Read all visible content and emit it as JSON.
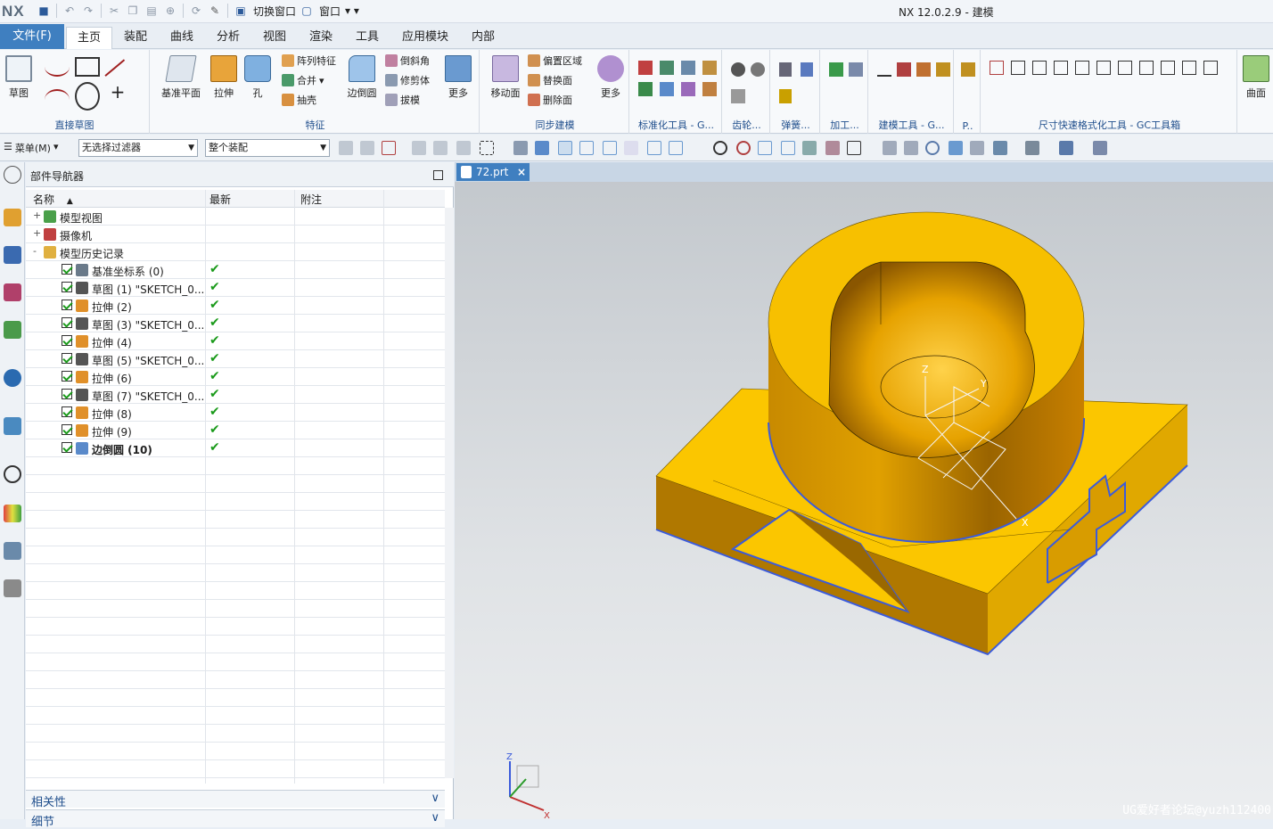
{
  "app": {
    "logo": "NX",
    "window_title": "NX 12.0.2.9 - 建模"
  },
  "qat": {
    "switch_window": "切换窗口",
    "window_menu": "窗口"
  },
  "tabs": [
    {
      "label": "文件(F)"
    },
    {
      "label": "主页"
    },
    {
      "label": "装配"
    },
    {
      "label": "曲线"
    },
    {
      "label": "分析"
    },
    {
      "label": "视图"
    },
    {
      "label": "渲染"
    },
    {
      "label": "工具"
    },
    {
      "label": "应用模块"
    },
    {
      "label": "内部"
    }
  ],
  "ribbon": {
    "sketch": "草图",
    "direct_sketch": "直接草图",
    "datum_plane": "基准平面",
    "extrude": "拉伸",
    "hole": "孔",
    "pattern_feature": "阵列特征",
    "unite": "合并",
    "shell": "抽壳",
    "edge_blend": "边倒圆",
    "chamfer": "倒斜角",
    "trim_body": "修剪体",
    "draft": "拔模",
    "more1": "更多",
    "feature": "特征",
    "move_face": "移动面",
    "offset_region": "偏置区域",
    "replace_face": "替换面",
    "delete_face": "删除面",
    "more2": "更多",
    "sync_modeling": "同步建模",
    "std_tools": "标准化工具 - G...",
    "gear": "齿轮...",
    "spring": "弹簧...",
    "machining": "加工...",
    "modeling_tools": "建模工具 - G...",
    "p_group": "P..",
    "dim_format": "尺寸快速格式化工具 - GC工具箱",
    "surface": "曲面"
  },
  "toolbar": {
    "menu": "菜单(M)",
    "filter": "无选择过滤器",
    "assembly": "整个装配"
  },
  "navigator": {
    "title": "部件导航器",
    "col_name": "名称",
    "col_latest": "最新",
    "col_note": "附注",
    "tree": [
      {
        "label": "模型视图",
        "level": 0,
        "checkbox": false,
        "ok": false,
        "expander": "+"
      },
      {
        "label": "摄像机",
        "level": 0,
        "checkbox": false,
        "ok": false,
        "expander": "+"
      },
      {
        "label": "模型历史记录",
        "level": 0,
        "checkbox": false,
        "ok": false,
        "expander": "-"
      },
      {
        "label": "基准坐标系 (0)",
        "level": 1,
        "checkbox": true,
        "ok": true
      },
      {
        "label": "草图 (1) \"SKETCH_0...",
        "level": 1,
        "checkbox": true,
        "ok": true
      },
      {
        "label": "拉伸 (2)",
        "level": 1,
        "checkbox": true,
        "ok": true
      },
      {
        "label": "草图 (3) \"SKETCH_0...",
        "level": 1,
        "checkbox": true,
        "ok": true
      },
      {
        "label": "拉伸 (4)",
        "level": 1,
        "checkbox": true,
        "ok": true
      },
      {
        "label": "草图 (5) \"SKETCH_0...",
        "level": 1,
        "checkbox": true,
        "ok": true
      },
      {
        "label": "拉伸 (6)",
        "level": 1,
        "checkbox": true,
        "ok": true
      },
      {
        "label": "草图 (7) \"SKETCH_0...",
        "level": 1,
        "checkbox": true,
        "ok": true
      },
      {
        "label": "拉伸 (8)",
        "level": 1,
        "checkbox": true,
        "ok": true
      },
      {
        "label": "拉伸 (9)",
        "level": 1,
        "checkbox": true,
        "ok": true
      },
      {
        "label": "边倒圆 (10)",
        "level": 1,
        "checkbox": true,
        "ok": true,
        "bold": true
      }
    ],
    "ok_mark": "✔",
    "dependencies": "相关性",
    "details": "细节",
    "chevron": "∨"
  },
  "viewport": {
    "tab": "72.prt",
    "close": "×",
    "axes": {
      "z": "Z",
      "y": "Y",
      "x": "X"
    },
    "watermark": "UG爱好者论坛@yuzh112400"
  },
  "colors": {
    "accent": "#3f7fc0",
    "part": "#f5c000",
    "edge": "#3b5bdb"
  }
}
